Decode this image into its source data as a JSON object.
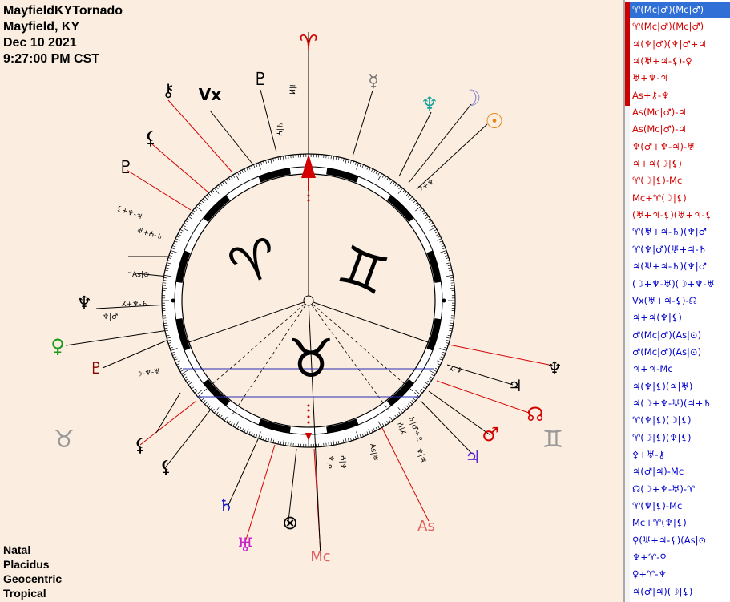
{
  "header": {
    "chart_name": "MayfieldKYTornado",
    "location": "Mayfield, KY",
    "date": "Dec 10 2021",
    "time": "9:27:00 PM CST"
  },
  "footer": {
    "chart_type": "Natal",
    "house_system": "Placidus",
    "perspective": "Geocentric",
    "zodiac": "Tropical"
  },
  "wheel": {
    "sign_labels": {
      "aries_top": "♈",
      "gemini_right": "♊",
      "taurus_left": "♉"
    },
    "inner_glyphs": {
      "aries": "♈",
      "gemini": "♊",
      "taurus": "♉"
    },
    "planets": {
      "chiron": "⚷",
      "vertex": "Vx",
      "pluto_top": "♇",
      "mercury": "☿",
      "neptune": "♆",
      "moon": "☽",
      "sun": "☉",
      "lilith": "⚸",
      "uranian_hades": "♇",
      "venus": "♀",
      "pluto_red": "♇",
      "uranian_admetos": "♆",
      "north_node": "☊",
      "mars": "♂",
      "jupiter": "♃",
      "descendant_sign": "♊",
      "saturn": "♄",
      "uranus": "♅",
      "mc": "Mc",
      "asc": "As",
      "part_of_fortune": "⊗",
      "uranian_kronos": "♃",
      "uranian_apollon": "♆",
      "uranian_zeus": "⚸",
      "uranian_cupido": "⚸"
    },
    "colors": {
      "background": "#fbeee0",
      "wheel_ring": "#ffffff",
      "aspect_red": "#d40000",
      "aspect_blue": "#0000cc",
      "asc_axis": "#000000",
      "neptune": "#1aa39a",
      "sun": "#e8861a",
      "moon": "#8888cc",
      "venus": "#1a9a1a",
      "mars": "#d40000",
      "jupiter": "#5a2ad0",
      "saturn": "#1a1acc",
      "uranus": "#cc22cc",
      "mc_asc": "#e06060",
      "pluto_red": "#8b0000",
      "gray_sign": "#999999",
      "midpoint_arrow": "#d40000"
    },
    "midpoint_notes": [
      "ⵍ|ⵏ",
      "ⵄ|♄",
      "☽+♆",
      "⚸+♆-♃",
      "♅+ⵄ-♄",
      "As|⊙",
      "ⵃ+♆-♄",
      "♆|♂",
      "☽-♆-♅",
      "ⵃ-♆",
      "♄|♂+♇",
      "ⵄ|ⵃ",
      "As|♅",
      "♆|♃",
      "♆|ⴰ",
      "ⵄ|♆"
    ]
  },
  "aspect_list": {
    "items": [
      {
        "text": "♈(Mc|♂)(Mc|♂)",
        "color": "red",
        "selected": true
      },
      {
        "text": "♈(Mc|♂)(Mc|♂)",
        "color": "red",
        "selected": false
      },
      {
        "text": "♃(♆|♂)(♆|♂+♃",
        "color": "red",
        "selected": false
      },
      {
        "text": "♃(♅+♃-⚸)-♀",
        "color": "red",
        "selected": false
      },
      {
        "text": "♅+♆-♃",
        "color": "red",
        "selected": false
      },
      {
        "text": "As+⚷-♆",
        "color": "red",
        "selected": false
      },
      {
        "text": "As(Mc|♂)-♃",
        "color": "red",
        "selected": false
      },
      {
        "text": "As(Mc|♂)-♃",
        "color": "red",
        "selected": false
      },
      {
        "text": "♆(♂+♆-♃)-♅",
        "color": "red",
        "selected": false
      },
      {
        "text": "♃+♃(☽|⚸)",
        "color": "red",
        "selected": false
      },
      {
        "text": "♈(☽|⚸)-Mc",
        "color": "red",
        "selected": false
      },
      {
        "text": "Mc+♈(☽|⚸)",
        "color": "red",
        "selected": false
      },
      {
        "text": "(♅+♃-⚸)(♅+♃-⚸",
        "color": "red",
        "selected": false
      },
      {
        "text": "♈(♅+♃-♄)(♆|♂",
        "color": "blue",
        "selected": false
      },
      {
        "text": "♈(♆|♂)(♅+♃-♄",
        "color": "blue",
        "selected": false
      },
      {
        "text": "♃(♅+♃-♄)(♆|♂",
        "color": "blue",
        "selected": false
      },
      {
        "text": "(☽+♆-♅)(☽+♆-♅",
        "color": "blue",
        "selected": false
      },
      {
        "text": "Vx(♅+♃-⚸)-☊",
        "color": "blue",
        "selected": false
      },
      {
        "text": "♃+♃(♆|⚸)",
        "color": "blue",
        "selected": false
      },
      {
        "text": "♂(Mc|♂)(As|⊙)",
        "color": "blue",
        "selected": false
      },
      {
        "text": "♂(Mc|♂)(As|⊙)",
        "color": "blue",
        "selected": false
      },
      {
        "text": "♃+♃-Mc",
        "color": "blue",
        "selected": false
      },
      {
        "text": "♃(♆|⚸)(♃|♅)",
        "color": "blue",
        "selected": false
      },
      {
        "text": "♃(☽+♆-♅)(♃+♄",
        "color": "blue",
        "selected": false
      },
      {
        "text": "♈(♆|⚸)(☽|⚸)",
        "color": "blue",
        "selected": false
      },
      {
        "text": "♈(☽|⚸)(♆|⚸)",
        "color": "blue",
        "selected": false
      },
      {
        "text": "⚴+♅-⚷",
        "color": "blue",
        "selected": false
      },
      {
        "text": "♃(♂|♃)-Mc",
        "color": "blue",
        "selected": false
      },
      {
        "text": "☊(☽+♆-♅)-♈",
        "color": "blue",
        "selected": false
      },
      {
        "text": "♈(♆|⚸)-Mc",
        "color": "blue",
        "selected": false
      },
      {
        "text": "Mc+♈(♆|⚸)",
        "color": "blue",
        "selected": false
      },
      {
        "text": "♀(♅+♃-⚸)(As|⊙",
        "color": "blue",
        "selected": false
      },
      {
        "text": "♆+♈-♀",
        "color": "blue",
        "selected": false
      },
      {
        "text": "♀+♈-♆",
        "color": "blue",
        "selected": false
      },
      {
        "text": "♃(♂|♃)(☽|⚸)",
        "color": "blue",
        "selected": false
      },
      {
        "text": "♃(☽+♆-♅)-♀",
        "color": "blue",
        "selected": false
      }
    ]
  }
}
